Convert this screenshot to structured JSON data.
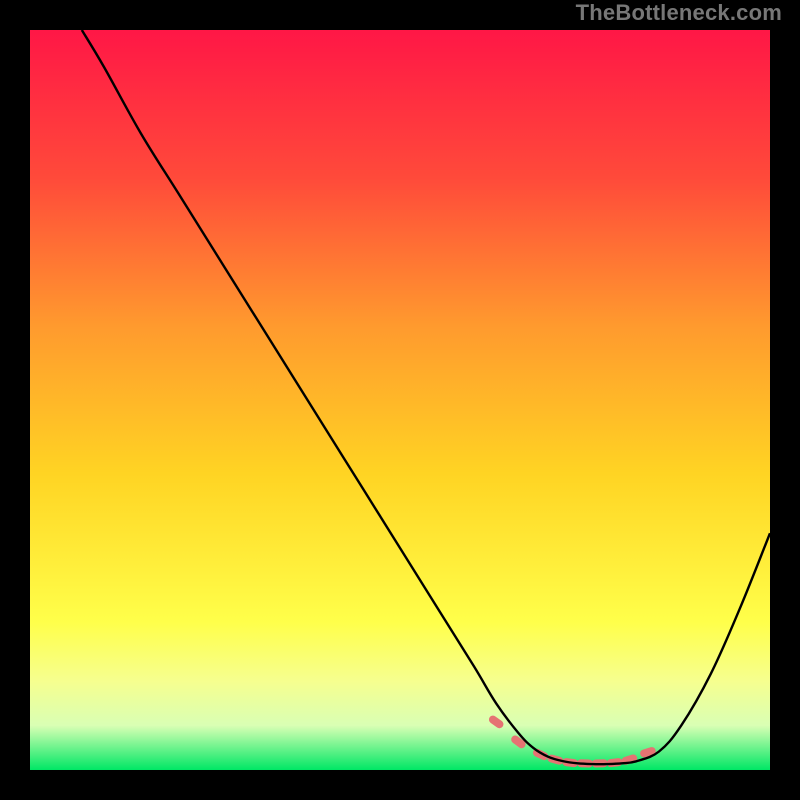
{
  "watermark": "TheBottleneck.com",
  "chart_data": {
    "type": "line",
    "title": "",
    "xlabel": "",
    "ylabel": "",
    "xlim": [
      0,
      100
    ],
    "ylim": [
      0,
      100
    ],
    "grid": false,
    "background_gradient": {
      "stops": [
        {
          "offset": 0.0,
          "color": "#ff1746"
        },
        {
          "offset": 0.2,
          "color": "#ff4a3a"
        },
        {
          "offset": 0.4,
          "color": "#ff9a2e"
        },
        {
          "offset": 0.6,
          "color": "#ffd423"
        },
        {
          "offset": 0.8,
          "color": "#ffff4a"
        },
        {
          "offset": 0.88,
          "color": "#f6ff8f"
        },
        {
          "offset": 0.94,
          "color": "#d9ffb4"
        },
        {
          "offset": 1.0,
          "color": "#00e765"
        }
      ]
    },
    "series": [
      {
        "name": "curve",
        "color": "#000000",
        "x": [
          7,
          10,
          15,
          20,
          25,
          30,
          35,
          40,
          45,
          50,
          55,
          60,
          63,
          66,
          68,
          70,
          72,
          74,
          76,
          78,
          80,
          82,
          85,
          88,
          92,
          96,
          100
        ],
        "y": [
          100,
          95,
          86,
          78,
          70,
          62,
          54,
          46,
          38,
          30,
          22,
          14,
          9,
          5,
          3,
          1.8,
          1.2,
          0.9,
          0.8,
          0.8,
          0.9,
          1.2,
          2.5,
          6,
          13,
          22,
          32
        ]
      }
    ],
    "markers": {
      "name": "bottom-highlight",
      "color": "#e57373",
      "shape": "pill",
      "x": [
        63,
        66,
        69,
        71,
        73,
        75,
        77,
        79,
        81,
        83.5
      ],
      "y": [
        6.5,
        3.8,
        2.1,
        1.4,
        1.0,
        0.9,
        0.9,
        1.0,
        1.4,
        2.4
      ]
    }
  }
}
